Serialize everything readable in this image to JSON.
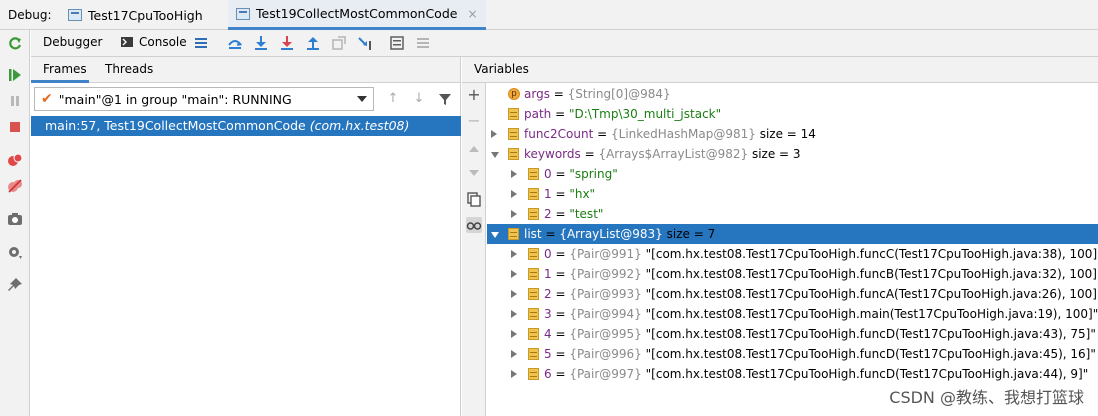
{
  "topbar": {
    "debug_label": "Debug:",
    "tabs": [
      {
        "label": "Test17CpuTooHigh"
      },
      {
        "label": "Test19CollectMostCommonCode",
        "close": "×"
      }
    ]
  },
  "debugger_toolbar": {
    "debugger_tab": "Debugger",
    "console_tab": "Console"
  },
  "frames": {
    "tabs": [
      "Frames",
      "Threads"
    ],
    "thread_selector": "\"main\"@1 in group \"main\": RUNNING",
    "selected_frame": {
      "method": "main:57, Test19CollectMostCommonCode",
      "package": "(com.hx.test08)"
    }
  },
  "variables": {
    "header": "Variables",
    "rows": [
      {
        "name": "args",
        "eq": " = ",
        "ref": "{String[0]@984}",
        "extra": ""
      },
      {
        "name": "path",
        "eq": " = ",
        "str": "\"D:\\Tmp\\30_multi_jstack\""
      },
      {
        "name": "func2Count",
        "eq": " = ",
        "ref": "{LinkedHashMap@981}",
        "extra": "  size = 14"
      },
      {
        "name": "keywords",
        "eq": " = ",
        "ref": "{Arrays$ArrayList@982}",
        "extra": "  size = 3"
      },
      {
        "name": "0",
        "eq": " = ",
        "str": "\"spring\""
      },
      {
        "name": "1",
        "eq": " = ",
        "str": "\"hx\""
      },
      {
        "name": "2",
        "eq": " = ",
        "str": "\"test\""
      },
      {
        "name": "list",
        "eq": " = ",
        "ref": "{ArrayList@983}",
        "extra": "  size = 7"
      },
      {
        "name": "0",
        "eq": " = ",
        "ref": "{Pair@991}",
        "val": " \"[com.hx.test08.Test17CpuTooHigh.funcC(Test17CpuTooHigh.java:38), 100]\""
      },
      {
        "name": "1",
        "eq": " = ",
        "ref": "{Pair@992}",
        "val": " \"[com.hx.test08.Test17CpuTooHigh.funcB(Test17CpuTooHigh.java:32), 100]\""
      },
      {
        "name": "2",
        "eq": " = ",
        "ref": "{Pair@993}",
        "val": " \"[com.hx.test08.Test17CpuTooHigh.funcA(Test17CpuTooHigh.java:26), 100]\""
      },
      {
        "name": "3",
        "eq": " = ",
        "ref": "{Pair@994}",
        "val": " \"[com.hx.test08.Test17CpuTooHigh.main(Test17CpuTooHigh.java:19), 100]\""
      },
      {
        "name": "4",
        "eq": " = ",
        "ref": "{Pair@995}",
        "val": " \"[com.hx.test08.Test17CpuTooHigh.funcD(Test17CpuTooHigh.java:43), 75]\""
      },
      {
        "name": "5",
        "eq": " = ",
        "ref": "{Pair@996}",
        "val": " \"[com.hx.test08.Test17CpuTooHigh.funcD(Test17CpuTooHigh.java:45), 16]\""
      },
      {
        "name": "6",
        "eq": " = ",
        "ref": "{Pair@997}",
        "val": " \"[com.hx.test08.Test17CpuTooHigh.funcD(Test17CpuTooHigh.java:44), 9]\""
      }
    ]
  },
  "watermark": "CSDN @教练、我想打篮球",
  "colors": {
    "selection": "#2675bf",
    "accent": "#4083c9"
  }
}
